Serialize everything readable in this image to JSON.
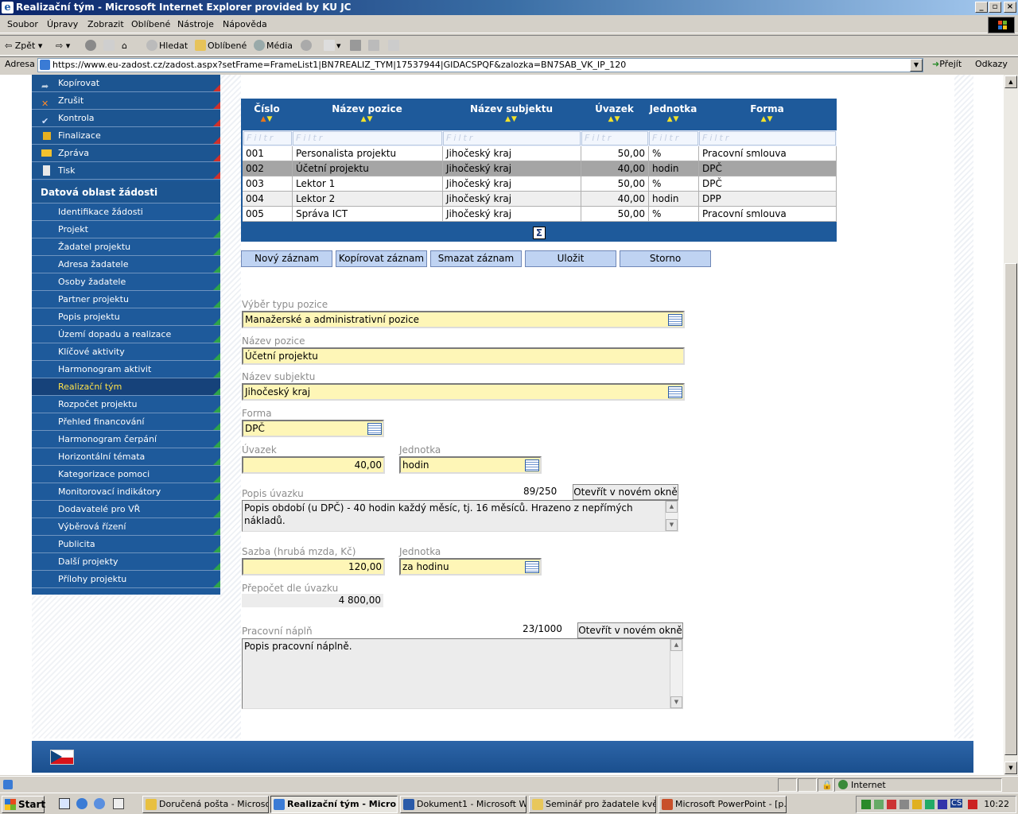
{
  "window": {
    "title": "Realizační tým - Microsoft Internet Explorer provided by KU JC"
  },
  "menu": [
    "Soubor",
    "Úpravy",
    "Zobrazit",
    "Oblíbené",
    "Nástroje",
    "Nápověda"
  ],
  "toolbar": {
    "back": "Zpět",
    "search": "Hledat",
    "favorites": "Oblíbené",
    "media": "Média"
  },
  "address": {
    "label": "Adresa",
    "url": "https://www.eu-zadost.cz/zadost.aspx?setFrame=FrameList1|BN7REALIZ_TYM|17537944|GIDACSPQF&zalozka=BN7SAB_VK_IP_120",
    "go": "Přejít",
    "links": "Odkazy"
  },
  "sidebar": {
    "actions": [
      {
        "label": "Kopírovat",
        "icon": "copy-icon"
      },
      {
        "label": "Zrušit",
        "icon": "cancel-icon"
      },
      {
        "label": "Kontrola",
        "icon": "check-icon"
      },
      {
        "label": "Finalizace",
        "icon": "lock-icon"
      },
      {
        "label": "Zpráva",
        "icon": "envelope-icon"
      },
      {
        "label": "Tisk",
        "icon": "print-icon"
      }
    ],
    "section_title": "Datová oblast žádosti",
    "items": [
      "Identifikace žádosti",
      "Projekt",
      "Žadatel projektu",
      "Adresa žadatele",
      "Osoby žadatele",
      "Partner projektu",
      "Popis projektu",
      "Území dopadu a realizace",
      "Klíčové aktivity",
      "Harmonogram aktivit",
      "Realizační tým",
      "Rozpočet projektu",
      "Přehled financování",
      "Harmonogram čerpání",
      "Horizontální témata",
      "Kategorizace pomoci",
      "Monitorovací indikátory",
      "Dodavatelé pro VŘ",
      "Výběrová řízení",
      "Publicita",
      "Další projekty",
      "Přílohy projektu"
    ],
    "active_item": "Realizační tým"
  },
  "grid": {
    "columns": [
      "Číslo",
      "Název pozice",
      "Název subjektu",
      "Úvazek",
      "Jednotka",
      "Forma"
    ],
    "filter_placeholder": "Filtr",
    "rows": [
      [
        "001",
        "Personalista projektu",
        "Jihočeský kraj",
        "50,00",
        "%",
        "Pracovní smlouva"
      ],
      [
        "002",
        "Účetní projektu",
        "Jihočeský kraj",
        "40,00",
        "hodin",
        "DPČ"
      ],
      [
        "003",
        "Lektor 1",
        "Jihočeský kraj",
        "50,00",
        "%",
        "DPČ"
      ],
      [
        "004",
        "Lektor 2",
        "Jihočeský kraj",
        "40,00",
        "hodin",
        "DPP"
      ],
      [
        "005",
        "Správa ICT",
        "Jihočeský kraj",
        "50,00",
        "%",
        "Pracovní smlouva"
      ]
    ],
    "selected_row": "002",
    "sum_symbol": "Σ"
  },
  "buttons": {
    "new": "Nový záznam",
    "copy": "Kopírovat záznam",
    "delete": "Smazat záznam",
    "save": "Uložit",
    "cancel": "Storno"
  },
  "form": {
    "position_type": {
      "label": "Výběr typu pozice",
      "value": "Manažerské a administrativní pozice"
    },
    "position_name": {
      "label": "Název pozice",
      "value": "Účetní projektu"
    },
    "subject_name": {
      "label": "Název subjektu",
      "value": "Jihočeský kraj"
    },
    "form_type": {
      "label": "Forma",
      "value": "DPČ"
    },
    "workload": {
      "label": "Úvazek",
      "value": "40,00"
    },
    "unit": {
      "label": "Jednotka",
      "value": "hodin"
    },
    "workload_desc": {
      "label": "Popis úvazku",
      "counter": "89/250",
      "open": "Otevřít v novém okně",
      "value": "Popis období (u DPČ) - 40 hodin každý měsíc, tj. 16 měsíců. Hrazeno z nepřímých nákladů."
    },
    "rate": {
      "label": "Sazba (hrubá mzda, Kč)",
      "value": "120,00"
    },
    "rate_unit": {
      "label": "Jednotka",
      "value": "za hodinu"
    },
    "recalc": {
      "label": "Přepočet dle úvazku",
      "value": "4 800,00"
    },
    "job_desc": {
      "label": "Pracovní náplň",
      "counter": "23/1000",
      "open": "Otevřít v novém okně",
      "value": "Popis pracovní náplně."
    }
  },
  "status": {
    "zone": "Internet"
  },
  "taskbar": {
    "start": "Start",
    "tasks": [
      "Doručená pošta - Microso...",
      "Realizační tým - Micro...",
      "Dokument1 - Microsoft W...",
      "Seminář pro žadatele kvě...",
      "Microsoft PowerPoint - [p..."
    ],
    "active_task": "Realizační tým - Micro...",
    "clock": "10:22",
    "lang": "CS"
  }
}
